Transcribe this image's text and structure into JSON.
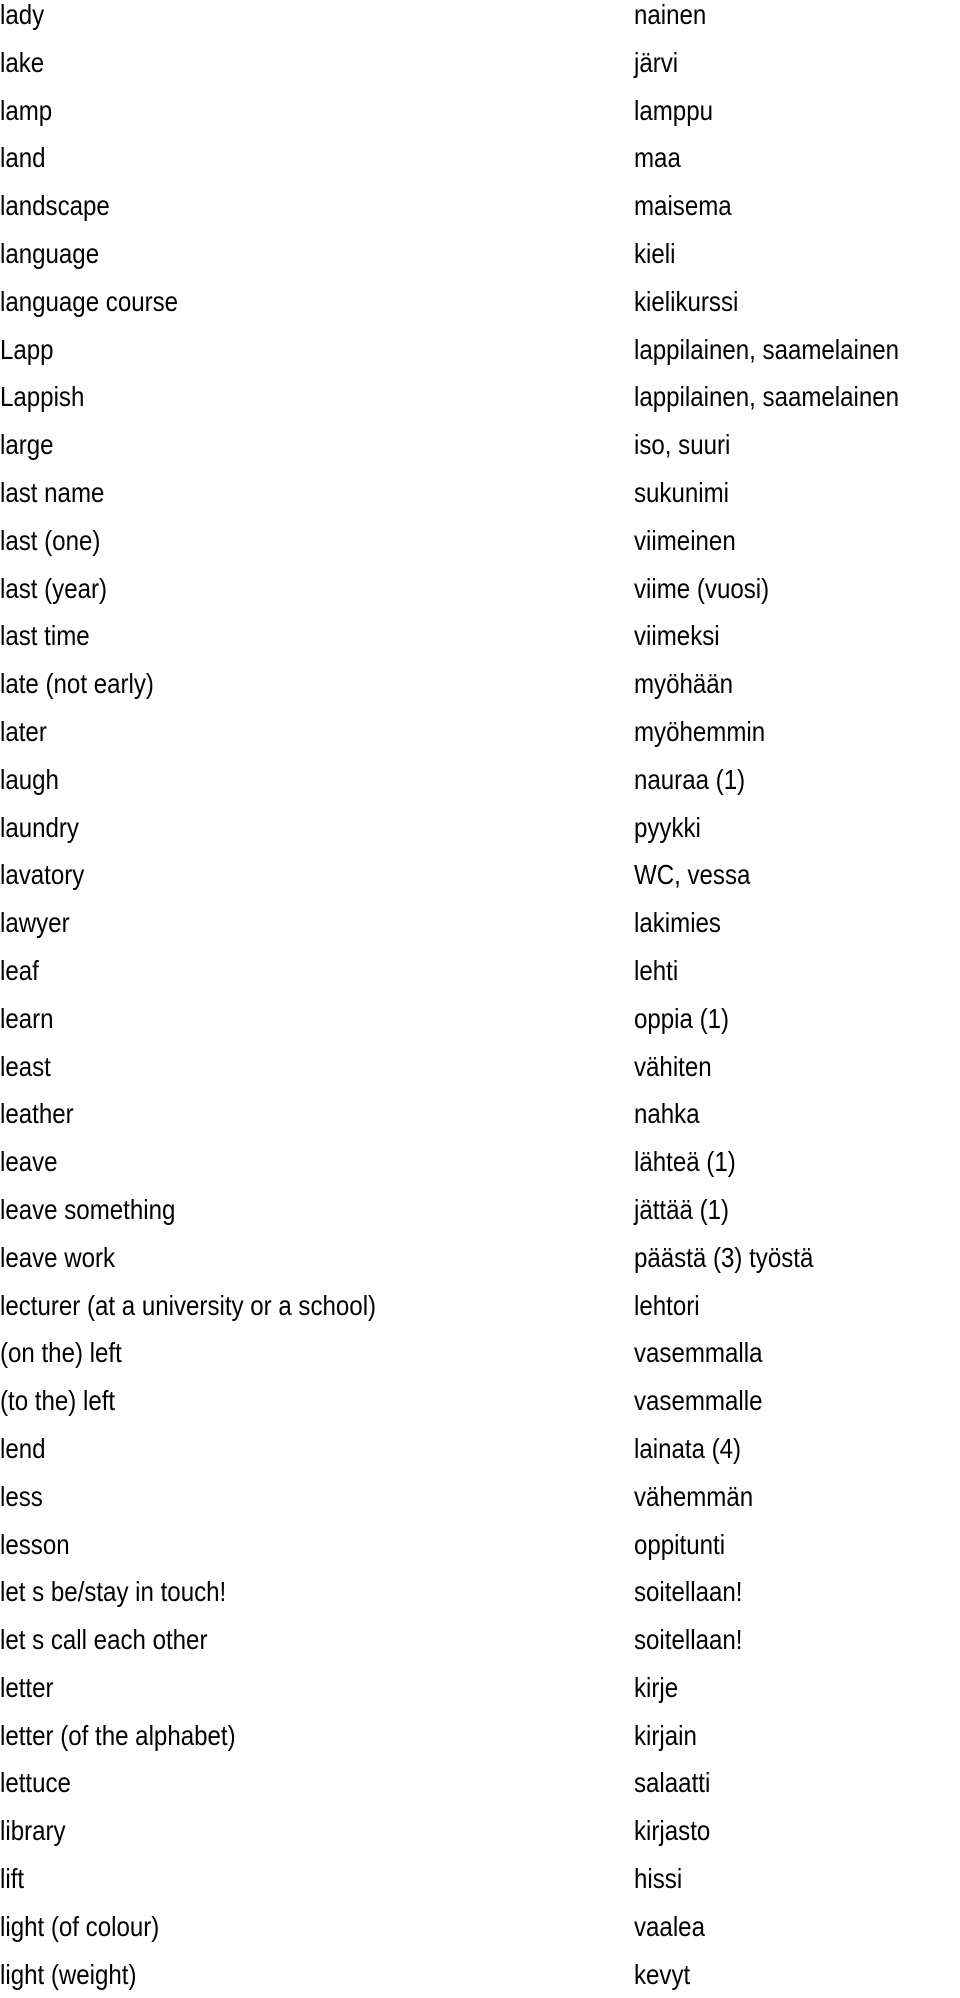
{
  "entries": [
    {
      "en": "lady",
      "fi": "nainen"
    },
    {
      "en": "lake",
      "fi": "järvi"
    },
    {
      "en": "lamp",
      "fi": "lamppu"
    },
    {
      "en": "land",
      "fi": "maa"
    },
    {
      "en": "landscape",
      "fi": "maisema"
    },
    {
      "en": "language",
      "fi": "kieli"
    },
    {
      "en": "language course",
      "fi": "kielikurssi"
    },
    {
      "en": "Lapp",
      "fi": "lappilainen, saamelainen"
    },
    {
      "en": "Lappish",
      "fi": "lappilainen, saamelainen"
    },
    {
      "en": "large",
      "fi": "iso, suuri"
    },
    {
      "en": "last name",
      "fi": "sukunimi"
    },
    {
      "en": "last (one)",
      "fi": "viimeinen"
    },
    {
      "en": "last (year)",
      "fi": "viime (vuosi)"
    },
    {
      "en": "last time",
      "fi": "viimeksi"
    },
    {
      "en": "late (not early)",
      "fi": "myöhään"
    },
    {
      "en": "later",
      "fi": "myöhemmin"
    },
    {
      "en": "laugh",
      "fi": "nauraa (1)"
    },
    {
      "en": "laundry",
      "fi": "pyykki"
    },
    {
      "en": "lavatory",
      "fi": "WC, vessa"
    },
    {
      "en": "lawyer",
      "fi": "lakimies"
    },
    {
      "en": "leaf",
      "fi": "lehti"
    },
    {
      "en": "learn",
      "fi": "oppia (1)"
    },
    {
      "en": "least",
      "fi": "vähiten"
    },
    {
      "en": "leather",
      "fi": "nahka"
    },
    {
      "en": "leave",
      "fi": "lähteä (1)"
    },
    {
      "en": "leave something",
      "fi": "jättää (1)"
    },
    {
      "en": "leave work",
      "fi": "päästä (3) työstä"
    },
    {
      "en": "lecturer (at a university or a school)",
      "fi": "lehtori"
    },
    {
      "en": "(on the) left",
      "fi": "vasemmalla"
    },
    {
      "en": "(to the) left",
      "fi": "vasemmalle"
    },
    {
      "en": "lend",
      "fi": "lainata (4)"
    },
    {
      "en": "less",
      "fi": "vähemmän"
    },
    {
      "en": "lesson",
      "fi": "oppitunti"
    },
    {
      "en": "let s be/stay in touch!",
      "fi": "soitellaan!"
    },
    {
      "en": "let s call each other",
      "fi": "soitellaan!"
    },
    {
      "en": "letter",
      "fi": "kirje"
    },
    {
      "en": "letter (of the alphabet)",
      "fi": "kirjain"
    },
    {
      "en": "lettuce",
      "fi": "salaatti"
    },
    {
      "en": "library",
      "fi": "kirjasto"
    },
    {
      "en": "lift",
      "fi": "hissi"
    },
    {
      "en": "light (of colour)",
      "fi": "vaalea"
    },
    {
      "en": "light (weight)",
      "fi": "kevyt"
    }
  ]
}
